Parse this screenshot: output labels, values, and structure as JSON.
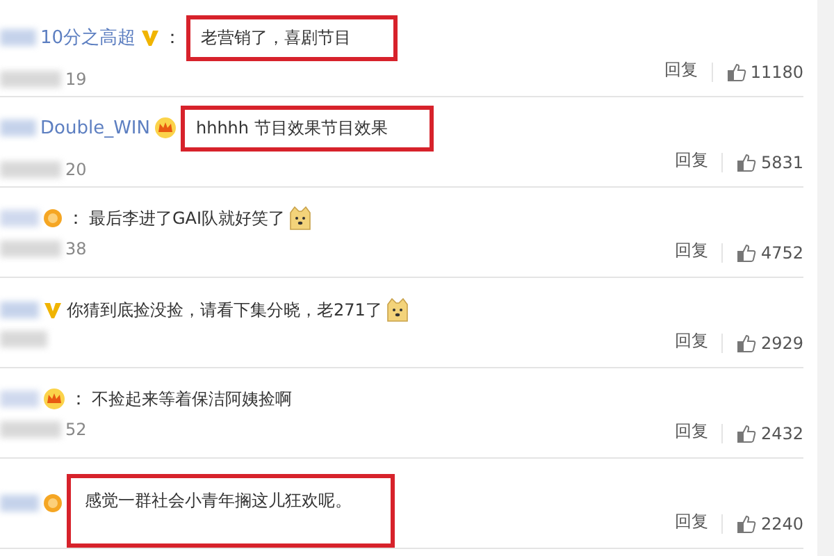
{
  "comments": [
    {
      "name": "10分之高超",
      "badge": {
        "kind": "vip"
      },
      "separator": "：",
      "text": "老营销了，喜剧节目",
      "highlighted": true,
      "time": "19",
      "reply": "回复",
      "likes": "11180"
    },
    {
      "name": "Double_WIN",
      "badge": {
        "kind": "crown"
      },
      "text": "hhhhh 节目效果节目效果",
      "highlighted": true,
      "time": "20",
      "reply": "回复",
      "likes": "5831"
    },
    {
      "badge": {
        "kind": "medal"
      },
      "separator": "：",
      "text": "最后李进了GAI队就好笑了",
      "highlighted": false,
      "emoji": true,
      "time": "38",
      "reply": "回复",
      "likes": "4752"
    },
    {
      "badge": {
        "kind": "vip"
      },
      "text": "你猜到底捡没捡，请看下集分晓，老271了",
      "highlighted": false,
      "emoji": true,
      "reply": "回复",
      "likes": "2929"
    },
    {
      "badge": {
        "kind": "crown"
      },
      "separator": "：",
      "text": "不捡起来等着保洁阿姨捡啊",
      "highlighted": false,
      "time": "52",
      "reply": "回复",
      "likes": "2432"
    },
    {
      "badge": {
        "kind": "medal"
      },
      "text": "感觉一群社会小青年搁这儿狂欢呢。",
      "highlighted": true,
      "tall": true,
      "reply": "回复",
      "likes": "2240"
    }
  ]
}
